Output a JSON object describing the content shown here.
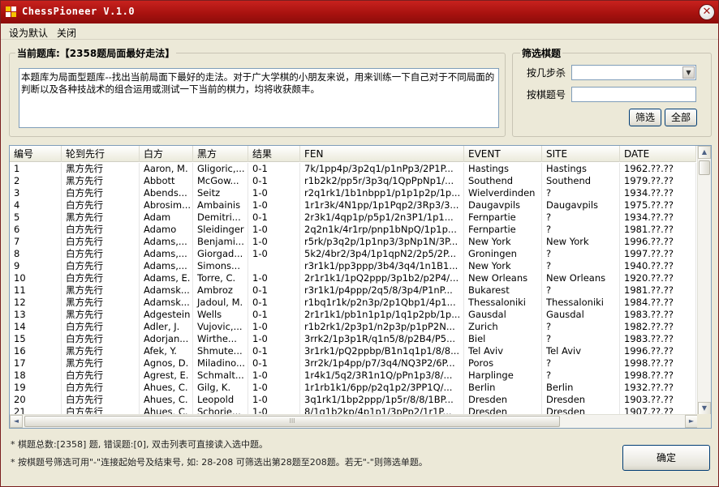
{
  "window": {
    "title": "ChessPioneer V.1.0",
    "close_glyph": "✕"
  },
  "menu": {
    "items": [
      "设为默认",
      "关闭"
    ]
  },
  "current_bank": {
    "label": "当前题库:【2358题局面最好走法】",
    "description": "本题库为局面型题库--找出当前局面下最好的走法。对于广大学棋的小朋友来说，用来训练一下自己对于不同局面的判断以及各种技战术的组合运用或测试一下当前的棋力，均将收获颇丰。"
  },
  "filter": {
    "title": "筛选棋题",
    "steps_label": "按几步杀",
    "steps_value": "",
    "number_label": "按棋题号",
    "number_value": "",
    "filter_button": "筛选",
    "all_button": "全部"
  },
  "table": {
    "columns": [
      "编号",
      "轮到先行",
      "白方",
      "黑方",
      "结果",
      "FEN",
      "EVENT",
      "SITE",
      "DATE"
    ],
    "rows": [
      [
        "1",
        "黑方先行",
        "Aaron, M.",
        "Gligoric,...",
        "0-1",
        "7k/1pp4p/3p2q1/p1nPp3/2P1P...",
        "Hastings",
        "Hastings",
        "1962.??.??"
      ],
      [
        "2",
        "黑方先行",
        "Abbott",
        "McGow...",
        "0-1",
        "r1b2k2/pp5r/3p3q/1QpPpNp1/...",
        "Southend",
        "Southend",
        "1979.??.??"
      ],
      [
        "3",
        "白方先行",
        "Abends...",
        "Seitz",
        "1-0",
        "r2q1rk1/1b1nbpp1/p1p1p2p/1p...",
        "Wielverdinden",
        "?",
        "1934.??.??"
      ],
      [
        "4",
        "白方先行",
        "Abrosim...",
        "Ambainis",
        "1-0",
        "1r1r3k/4N1pp/1p1Pqp2/3Rp3/3...",
        "Daugavpils",
        "Daugavpils",
        "1975.??.??"
      ],
      [
        "5",
        "黑方先行",
        "Adam",
        "Demitri...",
        "0-1",
        "2r3k1/4qp1p/p5p1/2n3P1/1p1...",
        "Fernpartie",
        "?",
        "1934.??.??"
      ],
      [
        "6",
        "白方先行",
        "Adamo",
        "Sleidinger",
        "1-0",
        "2q2n1k/4r1rp/pnp1bNpQ/1p1p...",
        "Fernpartie",
        "?",
        "1981.??.??"
      ],
      [
        "7",
        "白方先行",
        "Adams,...",
        "Benjami...",
        "1-0",
        "r5rk/p3q2p/1p1np3/3pNp1N/3P...",
        "New York",
        "New York",
        "1996.??.??"
      ],
      [
        "8",
        "白方先行",
        "Adams,...",
        "Giorgad...",
        "1-0",
        "5k2/4br2/3p4/1p1qpN2/2p5/2P...",
        "Groningen",
        "?",
        "1997.??.??"
      ],
      [
        "9",
        "白方先行",
        "Adams,...",
        "Simons...",
        "",
        "r3r1k1/pp3ppp/3b4/3q4/1n1B1...",
        "New York",
        "?",
        "1940.??.??"
      ],
      [
        "10",
        "白方先行",
        "Adams, E.",
        "Torre, C.",
        "1-0",
        "2r1r1k1/1pQ2ppp/3p1b2/p2P4/...",
        "New Orleans",
        "New Orleans",
        "1920.??.??"
      ],
      [
        "11",
        "黑方先行",
        "Adamsk...",
        "Ambroz",
        "0-1",
        "r3r1k1/p4ppp/2q5/8/3p4/P1nP...",
        "Bukarest",
        "?",
        "1981.??.??"
      ],
      [
        "12",
        "黑方先行",
        "Adamsk...",
        "Jadoul, M.",
        "0-1",
        "r1bq1r1k/p2n3p/2p1Qbp1/4p1...",
        "Thessaloniki",
        "Thessaloniki",
        "1984.??.??"
      ],
      [
        "13",
        "黑方先行",
        "Adgestein",
        "Wells",
        "0-1",
        "2r1r1k1/pb1n1p1p/1q1p2pb/1p...",
        "Gausdal",
        "Gausdal",
        "1983.??.??"
      ],
      [
        "14",
        "白方先行",
        "Adler, J.",
        "Vujovic,...",
        "1-0",
        "r1b2rk1/2p3p1/n2p3p/p1pP2N...",
        "Zurich",
        "?",
        "1982.??.??"
      ],
      [
        "15",
        "白方先行",
        "Adorjan...",
        "Wirthe...",
        "1-0",
        "3rrk2/1p3p1R/q1n5/8/p2B4/P5...",
        "Biel",
        "?",
        "1983.??.??"
      ],
      [
        "16",
        "黑方先行",
        "Afek, Y.",
        "Shmute...",
        "0-1",
        "3r1rk1/pQ2ppbp/B1n1q1p1/8/8...",
        "Tel Aviv",
        "Tel Aviv",
        "1996.??.??"
      ],
      [
        "17",
        "黑方先行",
        "Agnos, D.",
        "Miladino...",
        "0-1",
        "3rr2k/1p4pp/p7/3q4/NQ3P2/6P...",
        "Poros",
        "?",
        "1998.??.??"
      ],
      [
        "18",
        "白方先行",
        "Agrest, E.",
        "Schmalt...",
        "1-0",
        "1r4k1/5q2/3R1n1Q/pPn1p3/8/...",
        "Harplinge",
        "?",
        "1998.??.??"
      ],
      [
        "19",
        "白方先行",
        "Ahues, C.",
        "Gilg, K.",
        "1-0",
        "1r1rb1k1/6pp/p2q1p2/3PP1Q/...",
        "Berlin",
        "Berlin",
        "1932.??.??"
      ],
      [
        "20",
        "白方先行",
        "Ahues, C.",
        "Leopold",
        "1-0",
        "3q1rk1/1bp2ppp/1p5r/8/8/1BP...",
        "Dresden",
        "Dresden",
        "1903.??.??"
      ],
      [
        "21",
        "白方先行",
        "Ahues, C.",
        "Schorie...",
        "1-0",
        "8/1q1b2kp/4p1p1/3pPp2/1r1P...",
        "Dresden",
        "Dresden",
        "1907.??.??"
      ]
    ]
  },
  "scrollbar": {
    "up": "▲",
    "down": "▼",
    "left": "◄",
    "right": "►",
    "grip": "III"
  },
  "status": {
    "line1": "* 棋题总数:[2358] 题, 错误题:[0], 双击列表可直接读入选中题。",
    "line2": "* 按棋题号筛选可用\"-\"连接起始号及结束号, 如: 28-208 可筛选出第28题至208题。若无\"-\"则筛选单题。"
  },
  "confirm_button": "确定",
  "colors": {
    "titlebar": "#b0130f",
    "face": "#ece9d8",
    "input_border": "#7f9db9"
  }
}
